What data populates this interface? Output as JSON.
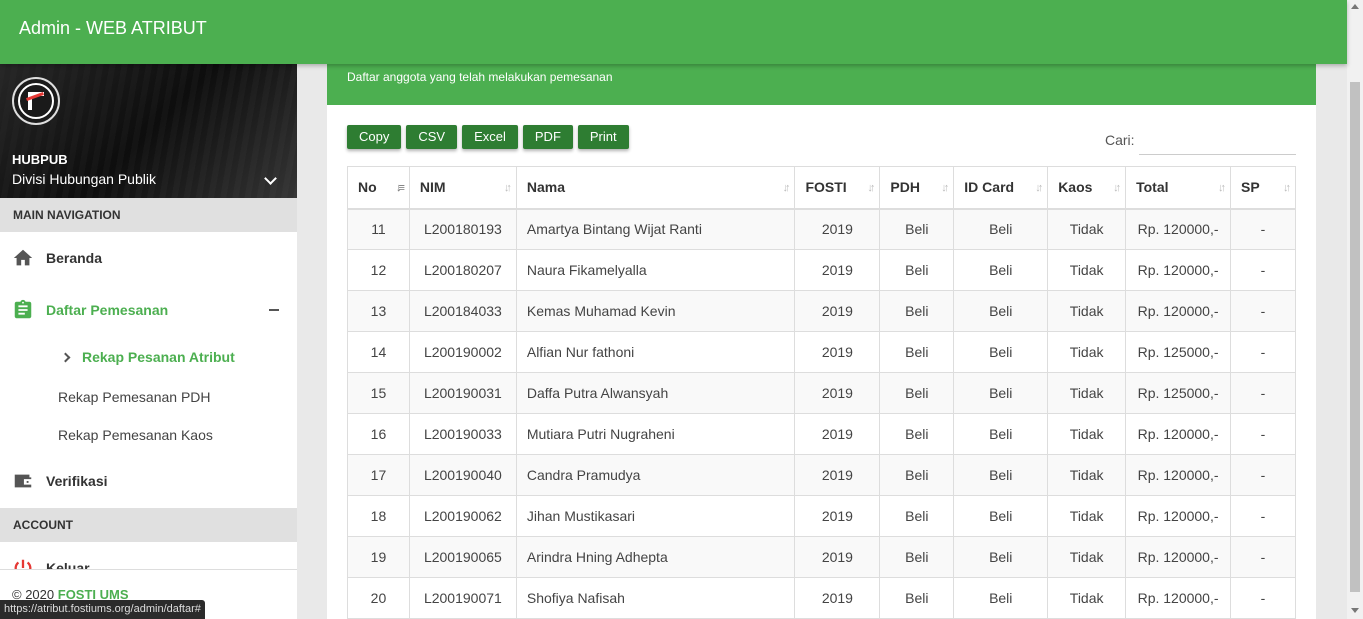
{
  "app_title": "Admin - WEB ATRIBUT",
  "user": {
    "name": "HUBPUB",
    "division": "Divisi Hubungan Publik"
  },
  "nav": {
    "main_header": "MAIN NAVIGATION",
    "beranda": "Beranda",
    "daftar": "Daftar Pemesanan",
    "sub": [
      "Rekap Pesanan Atribut",
      "Rekap Pemesanan PDH",
      "Rekap Pemesanan Kaos"
    ],
    "verifikasi": "Verifikasi",
    "account_header": "ACCOUNT",
    "keluar": "Keluar"
  },
  "footer": {
    "copy": "© 2020",
    "brand": "FOSTI UMS"
  },
  "status_url": "https://atribut.fostiums.org/admin/daftar#",
  "card": {
    "subtitle": "Daftar anggota yang telah melakukan pemesanan"
  },
  "buttons": [
    "Copy",
    "CSV",
    "Excel",
    "PDF",
    "Print"
  ],
  "search": {
    "label": "Cari:",
    "value": ""
  },
  "table": {
    "headers": [
      "No",
      "NIM",
      "Nama",
      "FOSTI",
      "PDH",
      "ID Card",
      "Kaos",
      "Total",
      "SP"
    ],
    "rows": [
      [
        "11",
        "L200180193",
        "Amartya Bintang Wijat Ranti",
        "2019",
        "Beli",
        "Beli",
        "Tidak",
        "Rp. 120000,-",
        "-"
      ],
      [
        "12",
        "L200180207",
        "Naura Fikamelyalla",
        "2019",
        "Beli",
        "Beli",
        "Tidak",
        "Rp. 120000,-",
        "-"
      ],
      [
        "13",
        "L200184033",
        "Kemas Muhamad Kevin",
        "2019",
        "Beli",
        "Beli",
        "Tidak",
        "Rp. 120000,-",
        "-"
      ],
      [
        "14",
        "L200190002",
        "Alfian Nur fathoni",
        "2019",
        "Beli",
        "Beli",
        "Tidak",
        "Rp. 125000,-",
        "-"
      ],
      [
        "15",
        "L200190031",
        "Daffa Putra Alwansyah",
        "2019",
        "Beli",
        "Beli",
        "Tidak",
        "Rp. 125000,-",
        "-"
      ],
      [
        "16",
        "L200190033",
        "Mutiara Putri Nugraheni",
        "2019",
        "Beli",
        "Beli",
        "Tidak",
        "Rp. 120000,-",
        "-"
      ],
      [
        "17",
        "L200190040",
        "Candra Pramudya",
        "2019",
        "Beli",
        "Beli",
        "Tidak",
        "Rp. 120000,-",
        "-"
      ],
      [
        "18",
        "L200190062",
        "Jihan Mustikasari",
        "2019",
        "Beli",
        "Beli",
        "Tidak",
        "Rp. 120000,-",
        "-"
      ],
      [
        "19",
        "L200190065",
        "Arindra Hning Adhepta",
        "2019",
        "Beli",
        "Beli",
        "Tidak",
        "Rp. 120000,-",
        "-"
      ],
      [
        "20",
        "L200190071",
        "Shofiya Nafisah",
        "2019",
        "Beli",
        "Beli",
        "Tidak",
        "Rp. 120000,-",
        "-"
      ]
    ]
  },
  "colors": {
    "primary": "#4caf50",
    "button": "#2e7d32"
  }
}
